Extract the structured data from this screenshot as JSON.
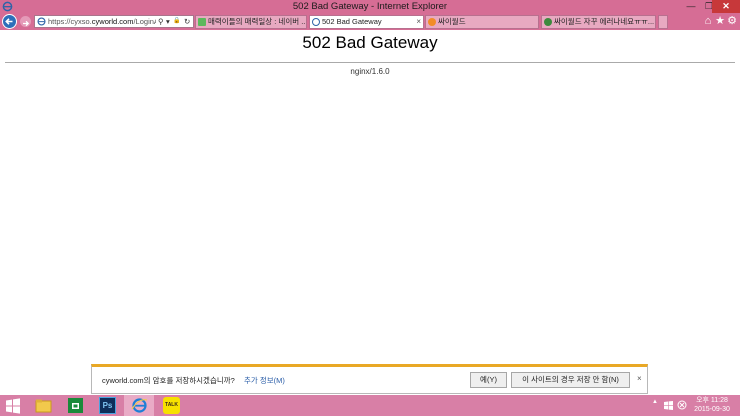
{
  "window": {
    "title": "502 Bad Gateway - Internet Explorer",
    "minimize_glyph": "—",
    "maximize_glyph": "❐",
    "close_glyph": "✕"
  },
  "address_bar": {
    "url_prefix": "https://cyxso.",
    "url_domain": "cyworld.com",
    "url_rest": "/LoginA",
    "search_glyph": "⚲",
    "dropdown_glyph": "▾",
    "lock_glyph": "🔒",
    "refresh_glyph": "↻"
  },
  "tabs": [
    {
      "label": "매력이들의 매력일상 : 네이버 ...",
      "active": false
    },
    {
      "label": "502 Bad Gateway",
      "active": true,
      "close": "×"
    },
    {
      "label": "싸이월드",
      "active": false
    },
    {
      "label": "싸이월드 자꾸 에러나네요ㅠㅠ...",
      "active": false
    }
  ],
  "toolbar": {
    "home_glyph": "⌂",
    "favorites_glyph": "★",
    "tools_glyph": "⚙"
  },
  "page": {
    "heading": "502 Bad Gateway",
    "server": "nginx/1.6.0"
  },
  "notification": {
    "message": "cyworld.com의 암호를 저장하시겠습니까?",
    "more_info": "추가 정보(M)",
    "yes_button": "예(Y)",
    "never_button": "이 사이트의 경우 저장 안 함(N)",
    "close_glyph": "×"
  },
  "taskbar": {
    "apps": [
      "start",
      "file-explorer",
      "store",
      "photoshop",
      "internet-explorer",
      "kakaotalk"
    ],
    "photoshop_label": "Ps",
    "kakaotalk_label": "TALK",
    "tray_arrow": "▲",
    "time": "오후 11:28",
    "date": "2015-09-30"
  },
  "colors": {
    "chrome_accent": "#d66d95",
    "taskbar": "#d87fa6",
    "notification_accent": "#e9a825",
    "close_button": "#c7383a"
  }
}
